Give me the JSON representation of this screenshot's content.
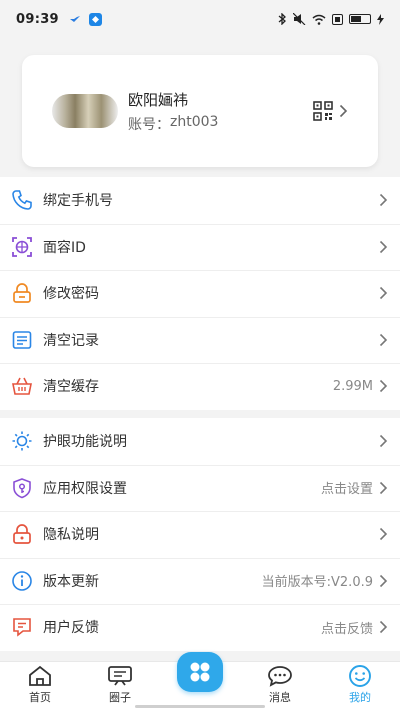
{
  "status_bar": {
    "time": "09:39"
  },
  "profile": {
    "name": "欧阳婳祎",
    "account_label": "账号：",
    "account_value": "zht003"
  },
  "group1": [
    {
      "label": "绑定手机号",
      "icon": "phone-icon",
      "value": ""
    },
    {
      "label": "面容ID",
      "icon": "face-id-icon",
      "value": ""
    },
    {
      "label": "修改密码",
      "icon": "lock-icon",
      "value": ""
    },
    {
      "label": "清空记录",
      "icon": "document-icon",
      "value": ""
    },
    {
      "label": "清空缓存",
      "icon": "basket-icon",
      "value": "2.99M"
    }
  ],
  "group2": [
    {
      "label": "护眼功能说明",
      "icon": "sun-icon",
      "value": ""
    },
    {
      "label": "应用权限设置",
      "icon": "shield-key-icon",
      "value": "点击设置"
    },
    {
      "label": "隐私说明",
      "icon": "padlock-icon",
      "value": ""
    },
    {
      "label": "版本更新",
      "icon": "info-icon",
      "value": "当前版本号:V2.0.9"
    },
    {
      "label": "用户反馈",
      "icon": "feedback-icon",
      "value": "点击反馈"
    }
  ],
  "tabbar": [
    {
      "label": "首页",
      "icon": "home-icon"
    },
    {
      "label": "圈子",
      "icon": "board-icon"
    },
    {
      "label": "",
      "icon": "apps-icon"
    },
    {
      "label": "消息",
      "icon": "chat-icon"
    },
    {
      "label": "我的",
      "icon": "smile-icon"
    }
  ],
  "colors": {
    "accent": "#2aa3e8",
    "orange": "#f08a24",
    "purple": "#8a4fd6",
    "red": "#e5553f"
  }
}
